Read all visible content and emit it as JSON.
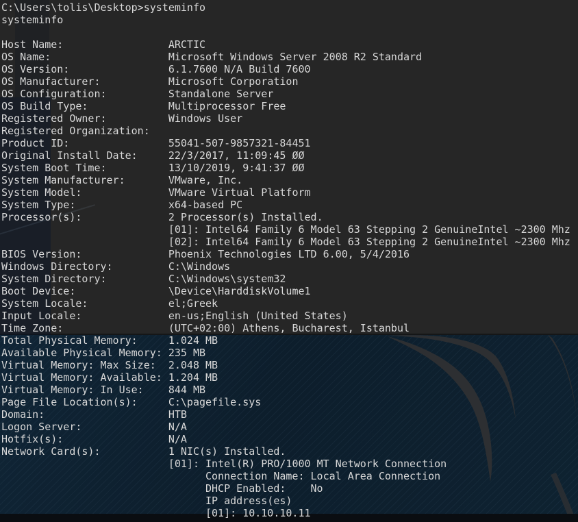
{
  "terminal": {
    "lines": [
      {
        "text": "C:\\Users\\tolis\\Desktop>systeminfo"
      },
      {
        "text": "systeminfo"
      },
      {
        "text": ""
      },
      {
        "label": "Host Name:",
        "value": "ARCTIC"
      },
      {
        "label": "OS Name:",
        "value": "Microsoft Windows Server 2008 R2 Standard"
      },
      {
        "label": "OS Version:",
        "value": "6.1.7600 N/A Build 7600"
      },
      {
        "label": "OS Manufacturer:",
        "value": "Microsoft Corporation"
      },
      {
        "label": "OS Configuration:",
        "value": "Standalone Server"
      },
      {
        "label": "OS Build Type:",
        "value": "Multiprocessor Free"
      },
      {
        "label": "Registered Owner:",
        "value": "Windows User"
      },
      {
        "label": "Registered Organization:",
        "value": ""
      },
      {
        "label": "Product ID:",
        "value": "55041-507-9857321-84451"
      },
      {
        "label": "Original Install Date:",
        "value": "22/3/2017, 11:09:45 ØØ"
      },
      {
        "label": "System Boot Time:",
        "value": "13/10/2019, 9:41:37 ØØ"
      },
      {
        "label": "System Manufacturer:",
        "value": "VMware, Inc."
      },
      {
        "label": "System Model:",
        "value": "VMware Virtual Platform"
      },
      {
        "label": "System Type:",
        "value": "x64-based PC"
      },
      {
        "label": "Processor(s):",
        "value": "2 Processor(s) Installed."
      },
      {
        "indent": 27,
        "value": "[01]: Intel64 Family 6 Model 63 Stepping 2 GenuineIntel ~2300 Mhz"
      },
      {
        "indent": 27,
        "value": "[02]: Intel64 Family 6 Model 63 Stepping 2 GenuineIntel ~2300 Mhz"
      },
      {
        "label": "BIOS Version:",
        "value": "Phoenix Technologies LTD 6.00, 5/4/2016"
      },
      {
        "label": "Windows Directory:",
        "value": "C:\\Windows"
      },
      {
        "label": "System Directory:",
        "value": "C:\\Windows\\system32"
      },
      {
        "label": "Boot Device:",
        "value": "\\Device\\HarddiskVolume1"
      },
      {
        "label": "System Locale:",
        "value": "el;Greek"
      },
      {
        "label": "Input Locale:",
        "value": "en-us;English (United States)"
      },
      {
        "label": "Time Zone:",
        "value": "(UTC+02:00) Athens, Bucharest, Istanbul"
      },
      {
        "label": "Total Physical Memory:",
        "value": "1.024 MB"
      },
      {
        "label": "Available Physical Memory:",
        "value": "235 MB"
      },
      {
        "label": "Virtual Memory: Max Size:",
        "value": "2.048 MB"
      },
      {
        "label": "Virtual Memory: Available:",
        "value": "1.204 MB"
      },
      {
        "label": "Virtual Memory: In Use:",
        "value": "844 MB"
      },
      {
        "label": "Page File Location(s):",
        "value": "C:\\pagefile.sys"
      },
      {
        "label": "Domain:",
        "value": "HTB"
      },
      {
        "label": "Logon Server:",
        "value": "N/A"
      },
      {
        "label": "Hotfix(s):",
        "value": "N/A"
      },
      {
        "label": "Network Card(s):",
        "value": "1 NIC(s) Installed."
      },
      {
        "indent": 27,
        "value": "[01]: Intel(R) PRO/1000 MT Network Connection"
      },
      {
        "indent": 33,
        "value": "Connection Name: Local Area Connection"
      },
      {
        "indent": 33,
        "value": "DHCP Enabled:    No"
      },
      {
        "indent": 33,
        "value": "IP address(es)"
      },
      {
        "indent": 33,
        "value": "[01]: 10.10.10.11"
      }
    ],
    "colors": {
      "background_top": "#262626",
      "background_bottom": "#0d1e2c",
      "text": "#d8d8d8",
      "swirl": "#2d2f32",
      "footer_bar": "#0a0d11"
    }
  }
}
